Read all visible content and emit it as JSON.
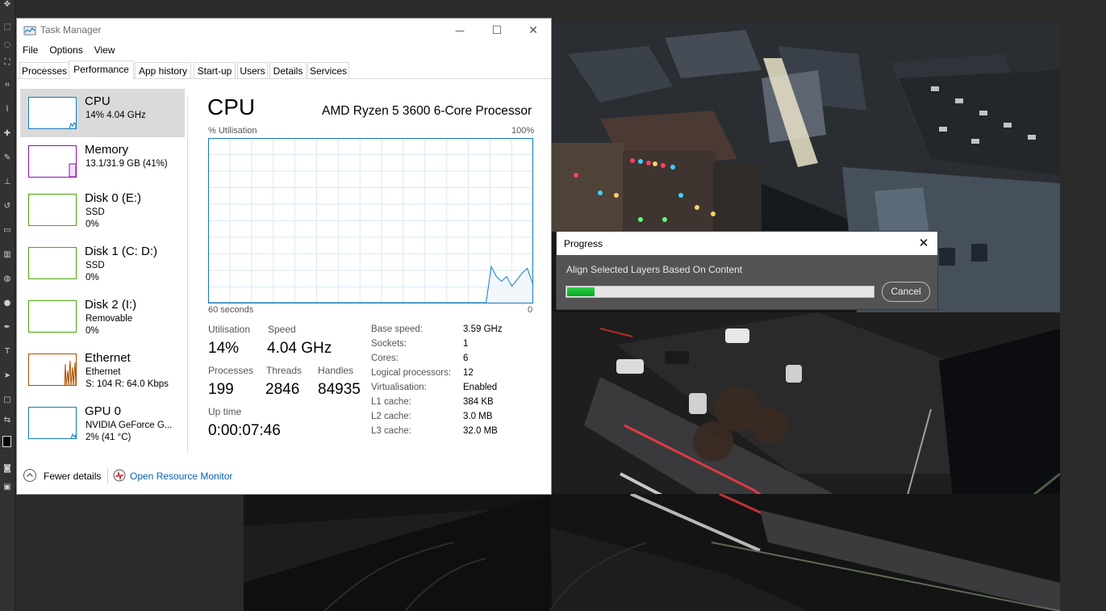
{
  "task_manager": {
    "title": "Task Manager",
    "window_buttons": {
      "minimize": "—",
      "maximize": "☐",
      "close": "✕"
    },
    "menu": [
      "File",
      "Options",
      "View"
    ],
    "tabs": [
      "Processes",
      "Performance",
      "App history",
      "Start-up",
      "Users",
      "Details",
      "Services"
    ],
    "active_tab": "Performance",
    "sidebar": [
      {
        "name": "CPU",
        "line1": "14%  4.04 GHz",
        "line2": "",
        "color": "#117dbb",
        "selected": true
      },
      {
        "name": "Memory",
        "line1": "13.1/31.9 GB (41%)",
        "line2": "",
        "color": "#8b12ae",
        "selected": false
      },
      {
        "name": "Disk 0 (E:)",
        "line1": "SSD",
        "line2": "0%",
        "color": "#4da60c",
        "selected": false
      },
      {
        "name": "Disk 1 (C: D:)",
        "line1": "SSD",
        "line2": "0%",
        "color": "#4da60c",
        "selected": false
      },
      {
        "name": "Disk 2 (I:)",
        "line1": "Removable",
        "line2": "0%",
        "color": "#4da60c",
        "selected": false
      },
      {
        "name": "Ethernet",
        "line1": "Ethernet",
        "line2": "S: 104  R: 64.0 Kbps",
        "color": "#a74f01",
        "selected": false
      },
      {
        "name": "GPU 0",
        "line1": "NVIDIA GeForce G...",
        "line2": "2%  (41 °C)",
        "color": "#117dbb",
        "selected": false
      }
    ],
    "cpu": {
      "heading": "CPU",
      "model": "AMD Ryzen 5 3600 6-Core Processor",
      "graph_label": "% Utilisation",
      "graph_max": "100%",
      "graph_time": "60 seconds",
      "graph_min": "0",
      "utilisation_label": "Utilisation",
      "utilisation": "14%",
      "speed_label": "Speed",
      "speed": "4.04 GHz",
      "processes_label": "Processes",
      "processes": "199",
      "threads_label": "Threads",
      "threads": "2846",
      "handles_label": "Handles",
      "handles": "84935",
      "uptime_label": "Up time",
      "uptime": "0:00:07:46",
      "specs": [
        {
          "key": "Base speed:",
          "value": "3.59 GHz"
        },
        {
          "key": "Sockets:",
          "value": "1"
        },
        {
          "key": "Cores:",
          "value": "6"
        },
        {
          "key": "Logical processors:",
          "value": "12"
        },
        {
          "key": "Virtualisation:",
          "value": "Enabled"
        },
        {
          "key": "L1 cache:",
          "value": "384 KB"
        },
        {
          "key": "L2 cache:",
          "value": "3.0 MB"
        },
        {
          "key": "L3 cache:",
          "value": "32.0 MB"
        }
      ],
      "graph_series": [
        0,
        0,
        0,
        0,
        0,
        0,
        0,
        0,
        0,
        0,
        0,
        0,
        0,
        0,
        0,
        0,
        0,
        0,
        0,
        0,
        0,
        0,
        0,
        0,
        0,
        0,
        0,
        0,
        0,
        0,
        0,
        0,
        0,
        0,
        0,
        0,
        0,
        0,
        0,
        0,
        0,
        0,
        0,
        0,
        0,
        0,
        0,
        0,
        0,
        0,
        0,
        0,
        0,
        0,
        0,
        22,
        16,
        13,
        16,
        10,
        14,
        18,
        21,
        12
      ],
      "graph_color": "#117dbb"
    },
    "footer": {
      "fewer_details": "Fewer details",
      "open_resource_monitor": "Open Resource Monitor"
    }
  },
  "progress_dialog": {
    "title": "Progress",
    "message": "Align Selected Layers Based On Content",
    "progress_fraction": 0.09,
    "cancel_label": "Cancel",
    "close_glyph": "✕"
  }
}
